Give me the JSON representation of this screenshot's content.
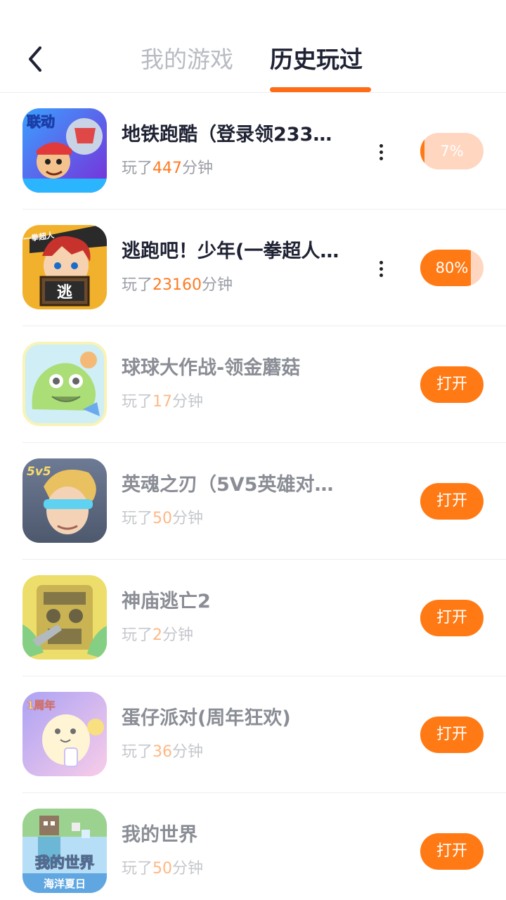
{
  "header": {
    "back_icon": "chevron-left-icon",
    "tabs": [
      {
        "label": "我的游戏",
        "active": false
      },
      {
        "label": "历史玩过",
        "active": true
      }
    ],
    "accent_color": "#ff6a14"
  },
  "games": [
    {
      "name": "地铁跑酷（登录领233…",
      "played_prefix": "玩了",
      "minutes": "447",
      "played_suffix": "分钟",
      "action": "progress",
      "progress_label": "7%",
      "progress": 0.07,
      "has_more_menu": true,
      "dimmed": false
    },
    {
      "name": "逃跑吧！少年(一拳超人…",
      "played_prefix": "玩了",
      "minutes": "23160",
      "played_suffix": "分钟",
      "action": "progress",
      "progress_label": "80%",
      "progress": 0.8,
      "has_more_menu": true,
      "dimmed": false
    },
    {
      "name": "球球大作战-领金蘑菇",
      "played_prefix": "玩了",
      "minutes": "17",
      "played_suffix": "分钟",
      "action": "open",
      "button_label": "打开",
      "has_more_menu": false,
      "dimmed": true
    },
    {
      "name": "英魂之刃（5V5英雄对…",
      "played_prefix": "玩了",
      "minutes": "50",
      "played_suffix": "分钟",
      "action": "open",
      "button_label": "打开",
      "has_more_menu": false,
      "dimmed": true
    },
    {
      "name": "神庙逃亡2",
      "played_prefix": "玩了",
      "minutes": "2",
      "played_suffix": "分钟",
      "action": "open",
      "button_label": "打开",
      "has_more_menu": false,
      "dimmed": true
    },
    {
      "name": "蛋仔派对(周年狂欢)",
      "played_prefix": "玩了",
      "minutes": "36",
      "played_suffix": "分钟",
      "action": "open",
      "button_label": "打开",
      "has_more_menu": false,
      "dimmed": true
    },
    {
      "name": "我的世界",
      "played_prefix": "玩了",
      "minutes": "50",
      "played_suffix": "分钟",
      "action": "open",
      "button_label": "打开",
      "has_more_menu": false,
      "dimmed": true
    }
  ],
  "icons": {
    "0": {
      "badge": "联动"
    },
    "1": {
      "badge": "一拳超人",
      "sign": "逃"
    },
    "3": {
      "badge": "5v5"
    },
    "5": {
      "badge": "1周年"
    },
    "6": {
      "badge": "我的世界",
      "sub": "海洋夏日"
    }
  }
}
